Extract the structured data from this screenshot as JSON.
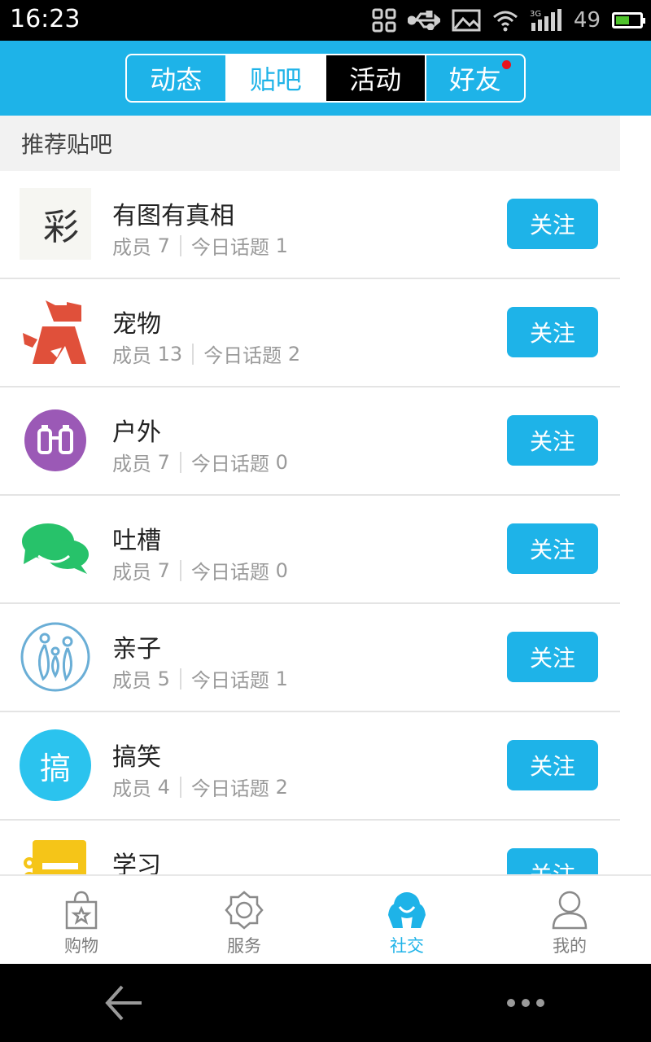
{
  "status_bar": {
    "time": "16:23",
    "network": "3G",
    "battery_level": "49"
  },
  "tabs": [
    {
      "label": "动态",
      "state": "normal",
      "badge": false
    },
    {
      "label": "贴吧",
      "state": "selected",
      "badge": false
    },
    {
      "label": "活动",
      "state": "dark",
      "badge": false
    },
    {
      "label": "好友",
      "state": "normal",
      "badge": true
    }
  ],
  "section_title": "推荐贴吧",
  "groups": [
    {
      "name": "有图有真相",
      "members_label": "成员",
      "members": "7",
      "topics_label": "今日话题",
      "topics": "1",
      "icon": "photo-logo",
      "icon_char": "彩",
      "follow": "关注"
    },
    {
      "name": "宠物",
      "members_label": "成员",
      "members": "13",
      "topics_label": "今日话题",
      "topics": "2",
      "icon": "dog-icon",
      "follow": "关注"
    },
    {
      "name": "户外",
      "members_label": "成员",
      "members": "7",
      "topics_label": "今日话题",
      "topics": "0",
      "icon": "binoculars-icon",
      "follow": "关注"
    },
    {
      "name": "吐槽",
      "members_label": "成员",
      "members": "7",
      "topics_label": "今日话题",
      "topics": "0",
      "icon": "chat-bubbles-icon",
      "follow": "关注"
    },
    {
      "name": "亲子",
      "members_label": "成员",
      "members": "5",
      "topics_label": "今日话题",
      "topics": "1",
      "icon": "family-icon",
      "follow": "关注"
    },
    {
      "name": "搞笑",
      "members_label": "成员",
      "members": "4",
      "topics_label": "今日话题",
      "topics": "2",
      "icon": "funny-icon",
      "icon_char": "搞",
      "follow": "关注"
    },
    {
      "name": "学习",
      "icon": "notebook-icon",
      "follow": "关注"
    }
  ],
  "bottom_nav": [
    {
      "label": "购物",
      "icon": "shopping-bag-icon",
      "active": false
    },
    {
      "label": "服务",
      "icon": "service-gear-icon",
      "active": false
    },
    {
      "label": "社交",
      "icon": "social-icon",
      "active": true
    },
    {
      "label": "我的",
      "icon": "profile-icon",
      "active": false
    }
  ],
  "colors": {
    "accent": "#1eb3e8",
    "badge": "#e8141c",
    "dog": "#e0503a",
    "outdoor": "#9b59b6",
    "chat": "#27c26a",
    "study": "#f5c518"
  }
}
